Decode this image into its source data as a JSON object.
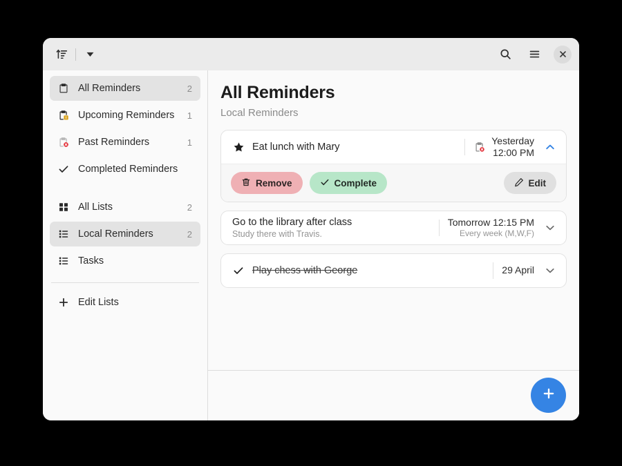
{
  "header": {
    "sort_icon": "sort-ascending-icon",
    "dropdown_icon": "chevron-down-icon",
    "search_icon": "search-icon",
    "menu_icon": "hamburger-menu-icon",
    "close_icon": "close-icon"
  },
  "sidebar": {
    "groups": [
      {
        "items": [
          {
            "label": "All Reminders",
            "count": "2",
            "icon": "clipboard-icon",
            "selected": true
          },
          {
            "label": "Upcoming Reminders",
            "count": "1",
            "icon": "clipboard-upcoming-icon",
            "selected": false
          },
          {
            "label": "Past Reminders",
            "count": "1",
            "icon": "clipboard-past-icon",
            "selected": false
          },
          {
            "label": "Completed Reminders",
            "count": "",
            "icon": "check-icon",
            "selected": false
          }
        ]
      },
      {
        "items": [
          {
            "label": "All Lists",
            "count": "2",
            "icon": "grid-icon",
            "selected": false
          },
          {
            "label": "Local Reminders",
            "count": "2",
            "icon": "list-icon",
            "selected": true
          },
          {
            "label": "Tasks",
            "count": "",
            "icon": "list-icon",
            "selected": false
          }
        ]
      }
    ],
    "edit_lists": {
      "label": "Edit Lists",
      "icon": "plus-icon"
    }
  },
  "main": {
    "title": "All Reminders",
    "subtitle": "Local Reminders",
    "reminders": [
      {
        "title": "Eat lunch with Mary",
        "subtitle": "",
        "lead_icon": "star-icon",
        "date_icon": "clipboard-past-icon",
        "date_main": "Yesterday",
        "date_sub": "12:00 PM",
        "date_stacked": true,
        "expanded": true,
        "completed": false,
        "actions": {
          "remove_label": "Remove",
          "remove_icon": "trash-icon",
          "complete_label": "Complete",
          "complete_icon": "check-icon",
          "edit_label": "Edit",
          "edit_icon": "pencil-icon"
        }
      },
      {
        "title": "Go to the library after class",
        "subtitle": "Study there with Travis.",
        "lead_icon": "",
        "date_icon": "",
        "date_main": "Tomorrow 12:15 PM",
        "date_sub": "Every week (M,W,F)",
        "date_stacked": false,
        "expanded": false,
        "completed": false
      },
      {
        "title": "Play chess with George",
        "subtitle": "",
        "lead_icon": "check-icon",
        "date_icon": "",
        "date_main": "29 April",
        "date_sub": "",
        "date_stacked": false,
        "expanded": false,
        "completed": true
      }
    ],
    "add_button_icon": "plus-icon"
  },
  "colors": {
    "accent": "#3584e4",
    "remove_bg": "#efb0b4",
    "complete_bg": "#b7e6c8",
    "edit_bg": "#e0e0e0",
    "sidebar_selected": "#e3e3e3"
  }
}
